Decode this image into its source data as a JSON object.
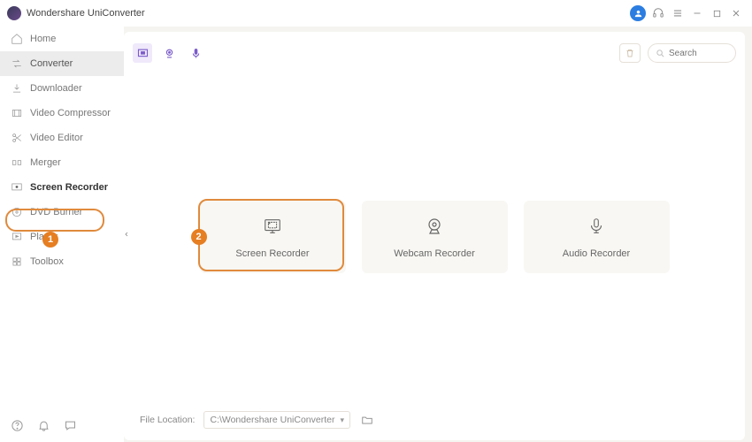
{
  "app": {
    "title": "Wondershare UniConverter"
  },
  "sidebar": {
    "items": [
      {
        "label": "Home"
      },
      {
        "label": "Converter"
      },
      {
        "label": "Downloader"
      },
      {
        "label": "Video Compressor"
      },
      {
        "label": "Video Editor"
      },
      {
        "label": "Merger"
      },
      {
        "label": "Screen Recorder"
      },
      {
        "label": "DVD Burner"
      },
      {
        "label": "Player"
      },
      {
        "label": "Toolbox"
      }
    ]
  },
  "search": {
    "placeholder": "Search"
  },
  "cards": [
    {
      "label": "Screen Recorder"
    },
    {
      "label": "Webcam Recorder"
    },
    {
      "label": "Audio Recorder"
    }
  ],
  "footer": {
    "label": "File Location:",
    "path": "C:\\Wondershare UniConverter"
  },
  "annotations": {
    "step1": "1",
    "step2": "2"
  }
}
